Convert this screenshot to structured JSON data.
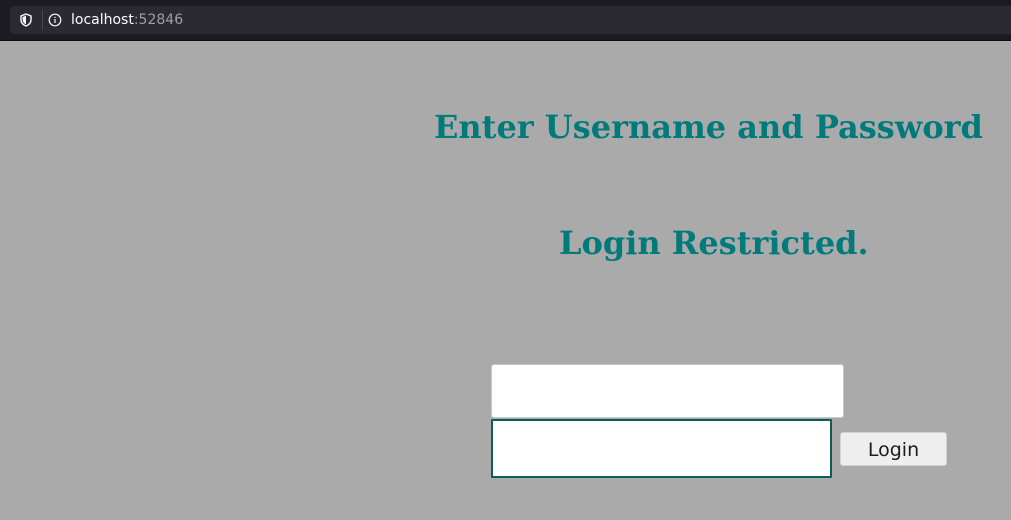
{
  "browser": {
    "url_host": "localhost",
    "url_port": ":52846"
  },
  "page": {
    "heading_1": "Enter Username and Password",
    "heading_2": "Login Restricted."
  },
  "form": {
    "username_value": "",
    "password_value": "",
    "login_label": "Login"
  },
  "icons": {
    "shield": "shield-icon",
    "info": "info-icon"
  },
  "colors": {
    "heading": "#007a7a",
    "background": "#abaaab",
    "focus_border": "#0a5f58"
  }
}
